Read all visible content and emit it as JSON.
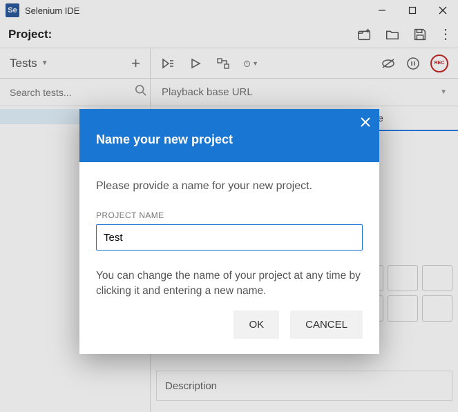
{
  "window": {
    "logo": "Se",
    "title": "Selenium IDE"
  },
  "project": {
    "label": "Project:"
  },
  "sidebar": {
    "tab_label": "Tests",
    "search_placeholder": "Search tests..."
  },
  "playback": {
    "url_placeholder": "Playback base URL"
  },
  "rec": {
    "label": "REC"
  },
  "columns": {
    "value": "Value"
  },
  "description": {
    "label": "Description"
  },
  "modal": {
    "title": "Name your new project",
    "prompt": "Please provide a name for your new project.",
    "field_label": "PROJECT NAME",
    "value": "Test",
    "hint": "You can change the name of your project at any time by clicking it and entering a new name.",
    "ok": "OK",
    "cancel": "CANCEL"
  }
}
